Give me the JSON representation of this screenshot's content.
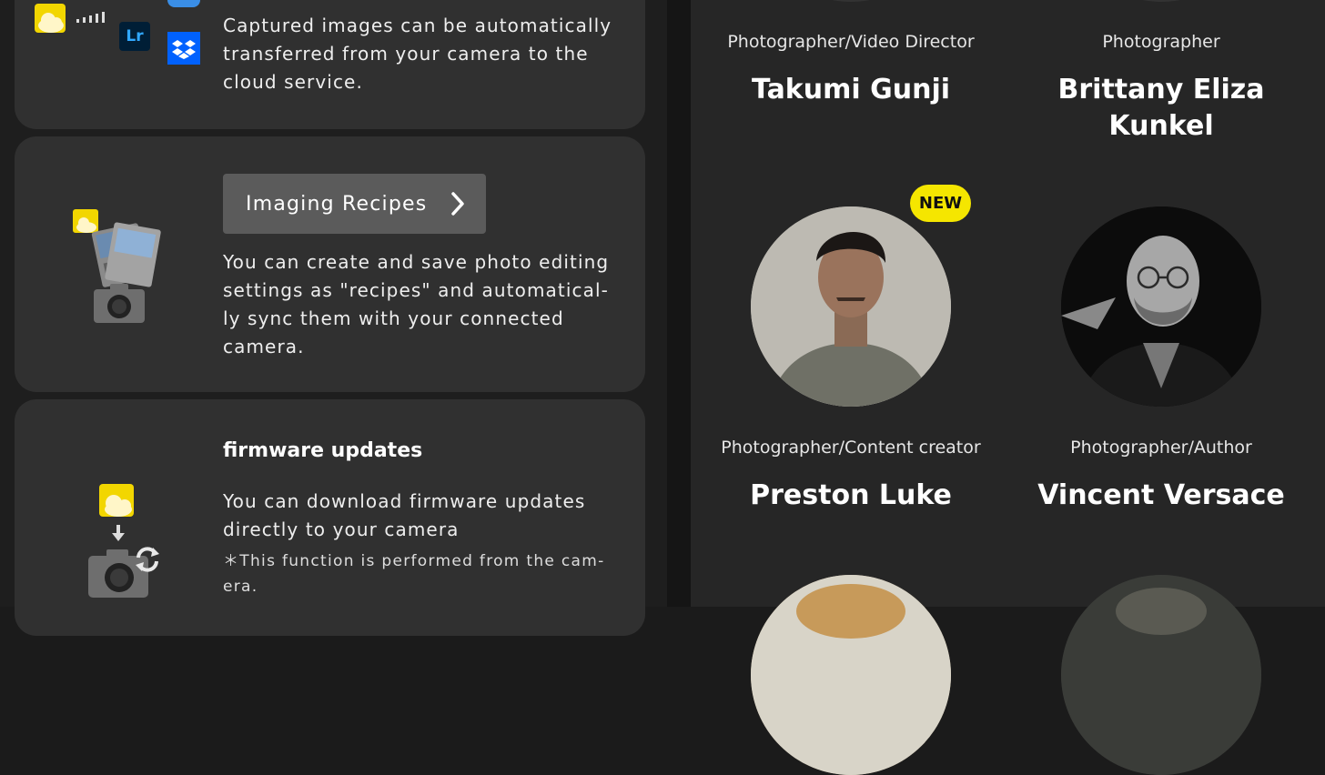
{
  "left": {
    "cloud_card": {
      "text": "Captured images can be automatically transferred from your camera to the cloud service."
    },
    "recipes_card": {
      "button_label": "Imaging Recipes",
      "text": "You can create and save photo editing settings as \"recipes\" and automatical-ly sync them with your connected camera."
    },
    "firmware_card": {
      "title": "firmware updates",
      "text": "You can download firmware updates directly to your camera",
      "note": "＊This function is performed from the cam-era."
    },
    "icons": {
      "lr_label": "Lr"
    }
  },
  "right": {
    "badge": "NEW",
    "people": [
      {
        "role": "Photographer/Video Director",
        "name": "Takumi Gunji"
      },
      {
        "role": "Photographer",
        "name": "Brittany Eliza Kunkel"
      },
      {
        "role": "Photographer/Content creator",
        "name": "Preston Luke"
      },
      {
        "role": "Photographer/Author",
        "name": "Vincent Versace"
      }
    ]
  },
  "colors": {
    "accent_yellow": "#f5e600",
    "cloud_yellow": "#f2d600",
    "dropbox_blue": "#0061fe",
    "lightroom_blue": "#31a8ff"
  }
}
